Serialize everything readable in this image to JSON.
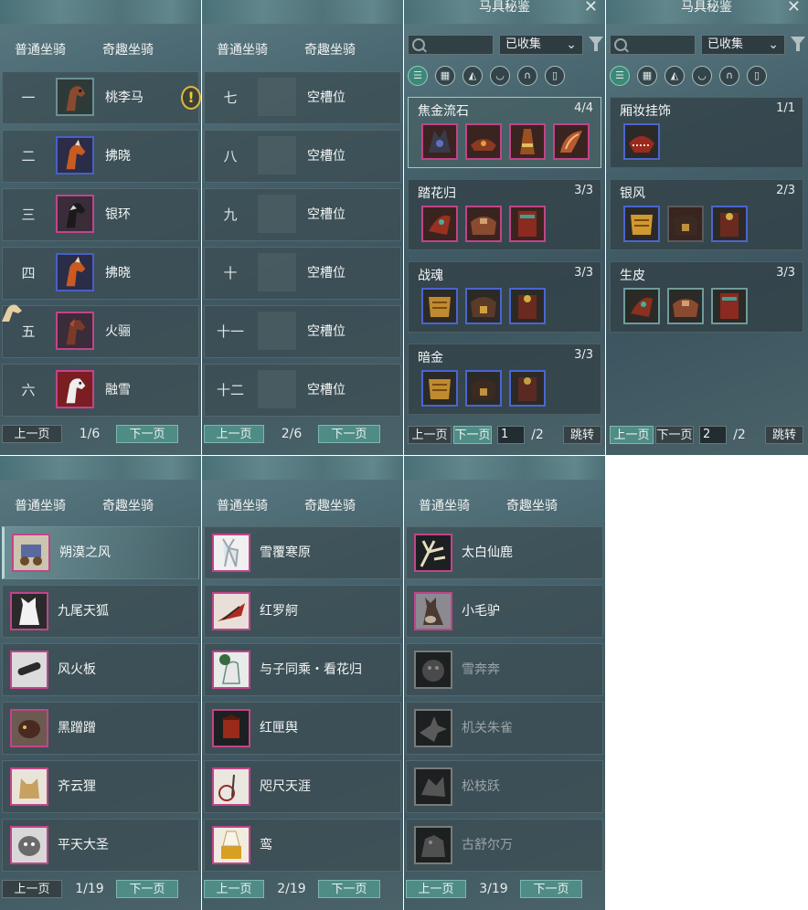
{
  "mount_tabs": {
    "normal": "普通坐骑",
    "fun": "奇趣坐骑"
  },
  "pager": {
    "prev": "上一页",
    "next": "下一页",
    "jump": "跳转"
  },
  "panel1": {
    "page": "1/6",
    "slots": [
      {
        "num": "一",
        "name": "桃李马"
      },
      {
        "num": "二",
        "name": "拂晓"
      },
      {
        "num": "三",
        "name": "银环"
      },
      {
        "num": "四",
        "name": "拂晓"
      },
      {
        "num": "五",
        "name": "火骊"
      },
      {
        "num": "六",
        "name": "融雪"
      }
    ]
  },
  "panel2": {
    "page": "2/6",
    "slots": [
      {
        "num": "七",
        "name": "空槽位"
      },
      {
        "num": "八",
        "name": "空槽位"
      },
      {
        "num": "九",
        "name": "空槽位"
      },
      {
        "num": "十",
        "name": "空槽位"
      },
      {
        "num": "十一",
        "name": "空槽位"
      },
      {
        "num": "十二",
        "name": "空槽位"
      }
    ]
  },
  "codex": {
    "title": "马具秘鉴",
    "filter_value": "已收集",
    "categories": [
      "list-icon",
      "grid-icon",
      "saddle-icon",
      "stirrup-icon",
      "horseshoe-icon",
      "armor-icon"
    ],
    "left": {
      "page_input": "1",
      "page_total": "/2",
      "sets": [
        {
          "name": "焦金流石",
          "count": "4/4"
        },
        {
          "name": "踏花归",
          "count": "3/3"
        },
        {
          "name": "战魂",
          "count": "3/3"
        },
        {
          "name": "暗金",
          "count": "3/3"
        }
      ]
    },
    "right": {
      "page_input": "2",
      "page_total": "/2",
      "sets": [
        {
          "name": "厢妆挂饰",
          "count": "1/1"
        },
        {
          "name": "银风",
          "count": "2/3"
        },
        {
          "name": "生皮",
          "count": "3/3"
        }
      ]
    }
  },
  "panel5": {
    "page": "1/19",
    "mounts": [
      "朔漠之风",
      "九尾天狐",
      "风火板",
      "黑蹭蹭",
      "齐云狸",
      "平天大圣"
    ]
  },
  "panel6": {
    "page": "2/19",
    "mounts": [
      "雪覆寒原",
      "红罗舸",
      "与子同乘・看花归",
      "红匣舆",
      "咫尺天涯",
      "鸾"
    ]
  },
  "panel7": {
    "page": "3/19",
    "mounts": [
      "太白仙鹿",
      "小毛驴",
      "雪奔奔",
      "机关朱雀",
      "松枝跃",
      "古舒尔万"
    ]
  },
  "colors": {
    "accent": "#4f8c86",
    "rare_border": "#c2448a",
    "epic_border": "#4660c8"
  }
}
